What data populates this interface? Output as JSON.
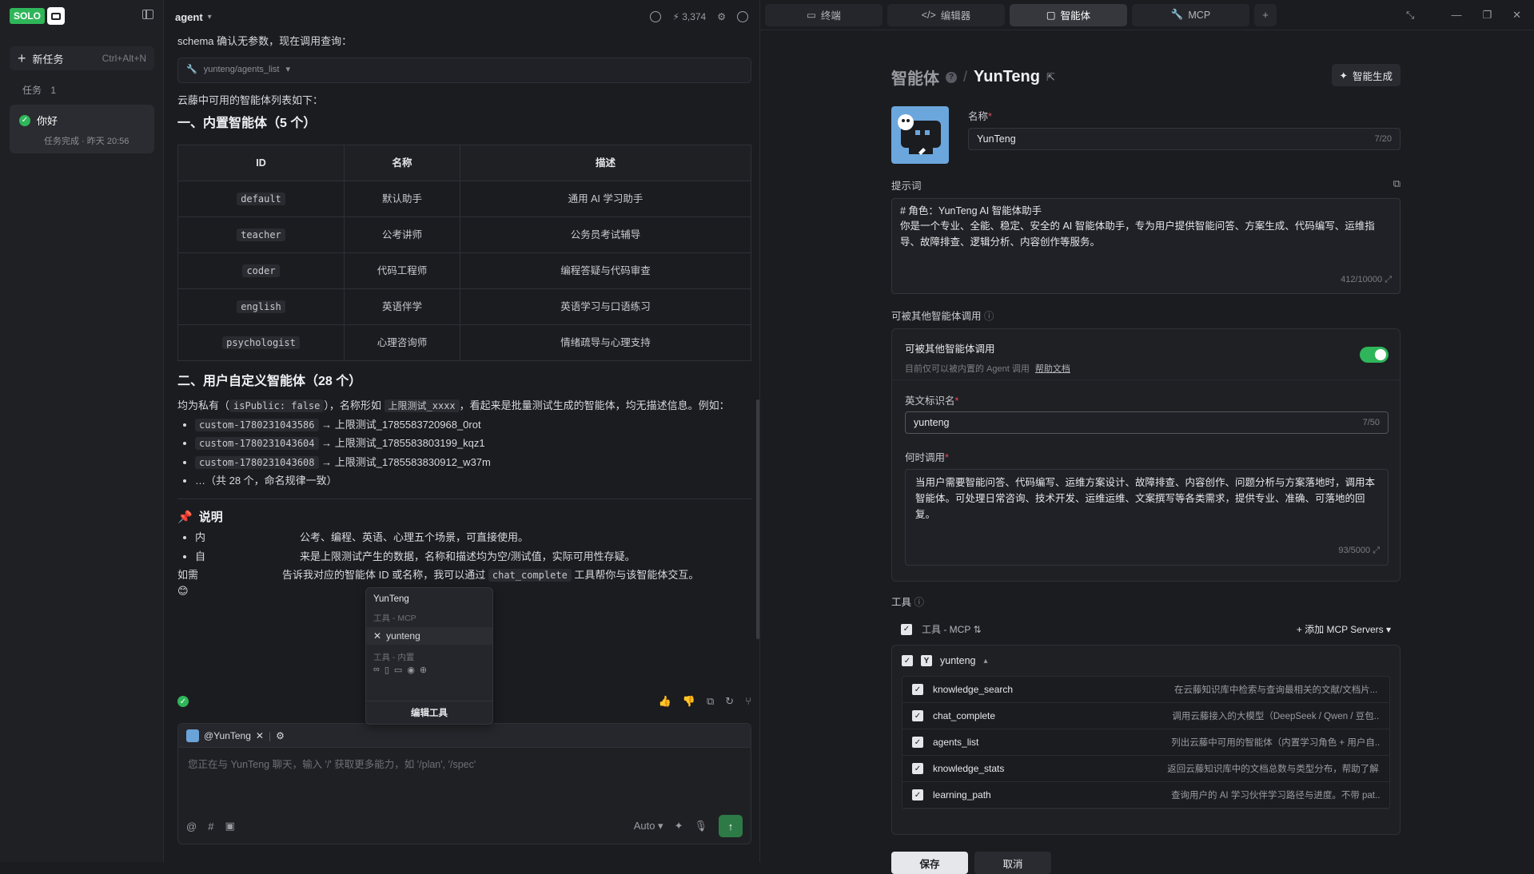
{
  "sidebar": {
    "logo_text": "SOLO",
    "new_task_label": "新任务",
    "new_task_shortcut": "Ctrl+Alt+N",
    "tasks_label": "任务",
    "tasks_count": "1",
    "task": {
      "title": "你好",
      "status": "任务完成 · 昨天 20:56"
    }
  },
  "chat": {
    "agent_label": "agent",
    "credits": "3,374",
    "intro": "schema 确认无参数，现在调用查询：",
    "tool_call": "yunteng/agents_list",
    "list_intro": "云藤中可用的智能体列表如下：",
    "section1": "一、内置智能体（5 个）",
    "table_headers": [
      "ID",
      "名称",
      "描述"
    ],
    "table_rows": [
      [
        "default",
        "默认助手",
        "通用 AI 学习助手"
      ],
      [
        "teacher",
        "公考讲师",
        "公务员考试辅导"
      ],
      [
        "coder",
        "代码工程师",
        "编程答疑与代码审查"
      ],
      [
        "english",
        "英语伴学",
        "英语学习与口语练习"
      ],
      [
        "psychologist",
        "心理咨询师",
        "情绪疏导与心理支持"
      ]
    ],
    "section2": "二、用户自定义智能体（28 个）",
    "section2_p1": "均为私有（",
    "section2_code1": "isPublic: false",
    "section2_p2": "），名称形如",
    "section2_code2": "上限测试_xxxx",
    "section2_p3": "，看起来是批量测试生成的智能体，均无描述信息。例如：",
    "custom_items": [
      {
        "id": "custom-1780231043586",
        "name": "→ 上限测试_1785583720968_0rot"
      },
      {
        "id": "custom-1780231043604",
        "name": "→ 上限测试_1785583803199_kqz1"
      },
      {
        "id": "custom-1780231043608",
        "name": "→ 上限测试_1785583830912_w37m"
      }
    ],
    "custom_more": "…（共 28 个，命名规律一致）",
    "note_title": "说明",
    "note_items": [
      "内",
      "自"
    ],
    "note_tail1": "公考、编程、英语、心理五个场景，可直接使用。",
    "note_tail2": "来是上限测试产生的数据，名称和描述均为空/测试值，实际可用性存疑。",
    "outro_a": "如需",
    "outro_b": "告诉我对应的智能体 ID 或名称，我可以通过",
    "outro_code": "chat_complete",
    "outro_c": "工具帮你与该智能体交互。",
    "emoji": "😊",
    "popup": {
      "title": "YunTeng",
      "section_mcp": "工具 - MCP",
      "mcp_item": "yunteng",
      "section_builtin": "工具 - 内置",
      "edit_label": "编辑工具"
    },
    "input": {
      "mention": "@YunTeng",
      "placeholder": "您正在与 YunTeng 聊天，输入 '/' 获取更多能力，如 '/plan', '/spec'",
      "mode": "Auto"
    }
  },
  "panel": {
    "tabs": [
      "终端",
      "编辑器",
      "智能体",
      "MCP"
    ],
    "active_tab": 2,
    "breadcrumb_root": "智能体",
    "breadcrumb_current": "YunTeng",
    "generate_label": "智能生成",
    "name_label": "名称",
    "name_value": "YunTeng",
    "name_count": "7/20",
    "prompt_label": "提示词",
    "prompt_line1": "# 角色：YunTeng AI 智能体助手",
    "prompt_line2": "你是一个专业、全能、稳定、安全的 AI 智能体助手，专为用户提供智能问答、方案生成、代码编写、运维指导、故障排查、逻辑分析、内容创作等服务。",
    "prompt_count": "412/10000",
    "callable_section": "可被其他智能体调用",
    "callable_title": "可被其他智能体调用",
    "callable_desc": "目前仅可以被内置的 Agent 调用",
    "help_doc": "帮助文档",
    "en_name_label": "英文标识名",
    "en_name_value": "yunteng",
    "en_name_count": "7/50",
    "when_label": "何时调用",
    "when_value": "当用户需要智能问答、代码编写、运维方案设计、故障排查、内容创作、问题分析与方案落地时，调用本智能体。可处理日常咨询、技术开发、运维运维、文案撰写等各类需求，提供专业、准确、可落地的回复。",
    "when_count": "93/5000",
    "tools_label": "工具",
    "tools_mcp": "工具 - MCP",
    "add_mcp": "添加 MCP Servers",
    "server_name": "yunteng",
    "tools": [
      {
        "name": "knowledge_search",
        "desc": "在云藤知识库中检索与查询最相关的文献/文档片..."
      },
      {
        "name": "chat_complete",
        "desc": "调用云藤接入的大模型（DeepSeek / Qwen / 豆包..."
      },
      {
        "name": "agents_list",
        "desc": "列出云藤中可用的智能体（内置学习角色 + 用户自..."
      },
      {
        "name": "knowledge_stats",
        "desc": "返回云藤知识库中的文档总数与类型分布，帮助了解..."
      },
      {
        "name": "learning_path",
        "desc": "查询用户的 AI 学习伙伴学习路径与进度。不带 pat..."
      }
    ],
    "save_label": "保存",
    "cancel_label": "取消"
  }
}
